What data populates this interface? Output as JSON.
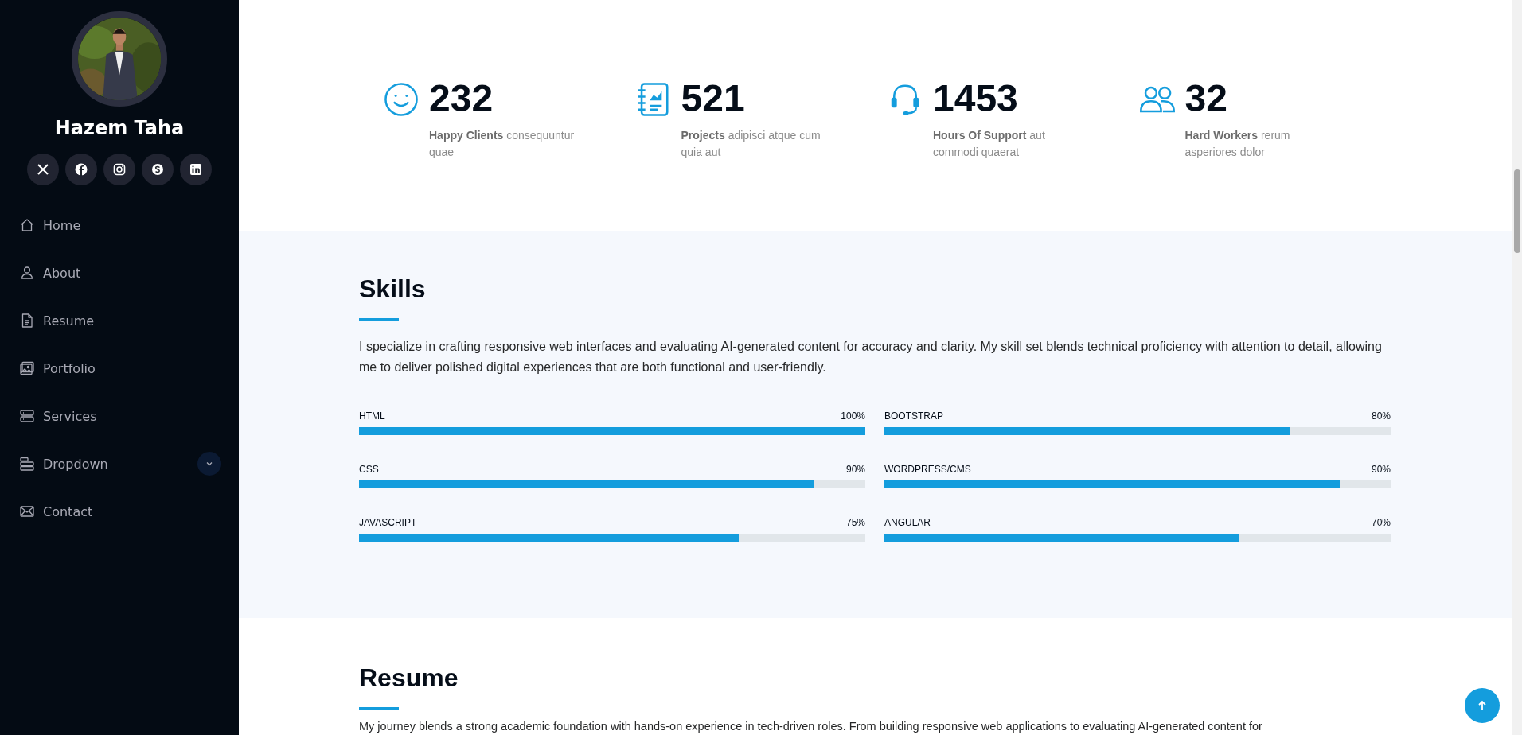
{
  "sidebar": {
    "name": "Hazem Taha",
    "social": [
      {
        "kind": "x"
      },
      {
        "kind": "facebook"
      },
      {
        "kind": "instagram"
      },
      {
        "kind": "skype"
      },
      {
        "kind": "linkedin"
      }
    ],
    "nav": [
      {
        "label": "Home",
        "kind": "home",
        "selected": false
      },
      {
        "label": "About",
        "kind": "person",
        "selected": false
      },
      {
        "label": "Resume",
        "kind": "document",
        "selected": false
      },
      {
        "label": "Portfolio",
        "kind": "images",
        "selected": false
      },
      {
        "label": "Services",
        "kind": "servers",
        "selected": false
      },
      {
        "label": "Dropdown",
        "kind": "stack",
        "selected": false,
        "expanded": false
      },
      {
        "label": "Contact",
        "kind": "envelope",
        "selected": false
      }
    ]
  },
  "stats": [
    {
      "kind": "smile",
      "number": "232",
      "text": "**Happy Clients** consequuntur quae"
    },
    {
      "kind": "journal",
      "number": "521",
      "text": "**Projects** adipisci atque cum quia aut"
    },
    {
      "kind": "headset",
      "number": "1453",
      "text": "**Hours Of Support** aut commodi quaerat"
    },
    {
      "kind": "people",
      "number": "32",
      "text": "**Hard Workers** rerum asperiores dolor"
    }
  ],
  "skills": {
    "title": "Skills",
    "description": "I specialize in crafting responsive web interfaces and evaluating AI-generated content for accuracy and clarity. My skill set blends technical proficiency with attention to detail, allowing me to deliver polished digital experiences that are both functional and user-friendly.",
    "items": [
      {
        "name": "HTML",
        "reading": "100%",
        "level": 1.0
      },
      {
        "name": "BOOTSTRAP",
        "reading": "80%",
        "level": 0.8
      },
      {
        "name": "CSS",
        "reading": "90%",
        "level": 0.9
      },
      {
        "name": "WORDPRESS/CMS",
        "reading": "90%",
        "level": 0.9
      },
      {
        "name": "JAVASCRIPT",
        "reading": "75%",
        "level": 0.75
      },
      {
        "name": "ANGULAR",
        "reading": "70%",
        "level": 0.7
      }
    ]
  },
  "resume": {
    "title": "Resume",
    "description": "My journey blends a strong academic foundation with hands-on experience in tech-driven roles. From building responsive web applications to evaluating AI-generated content for"
  }
}
